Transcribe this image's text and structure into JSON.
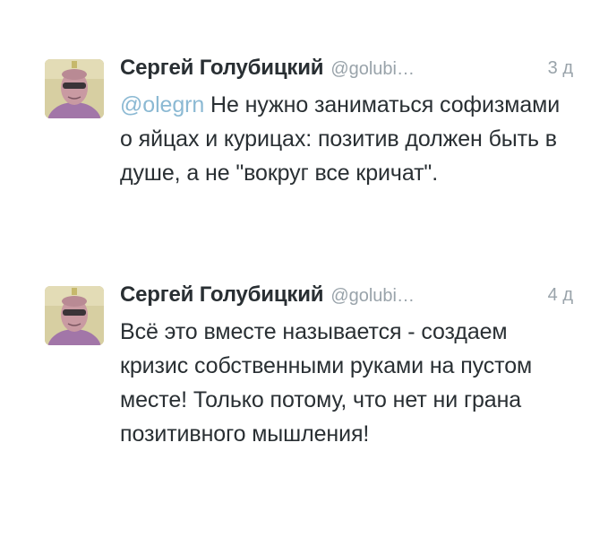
{
  "tweets": [
    {
      "author_name": "Сергей Голубицкий",
      "handle": "@golubi…",
      "time": "3 д",
      "mention": "@olegrn",
      "text": "Не нужно заниматься софизмами о яйцах и курицах: позитив должен быть в душе, а не \"вокруг все кричат\"."
    },
    {
      "author_name": "Сергей Голубицкий",
      "handle": "@golubi…",
      "time": "4 д",
      "text": "Всё это вместе называется - создаем кризис собственными руками на пустом месте! Только потому, что нет ни грана позитивного мышления!"
    }
  ],
  "colors": {
    "name": "#292f33",
    "meta": "#99a3aa",
    "mention": "#8bb9d3",
    "background": "#ffffff"
  }
}
